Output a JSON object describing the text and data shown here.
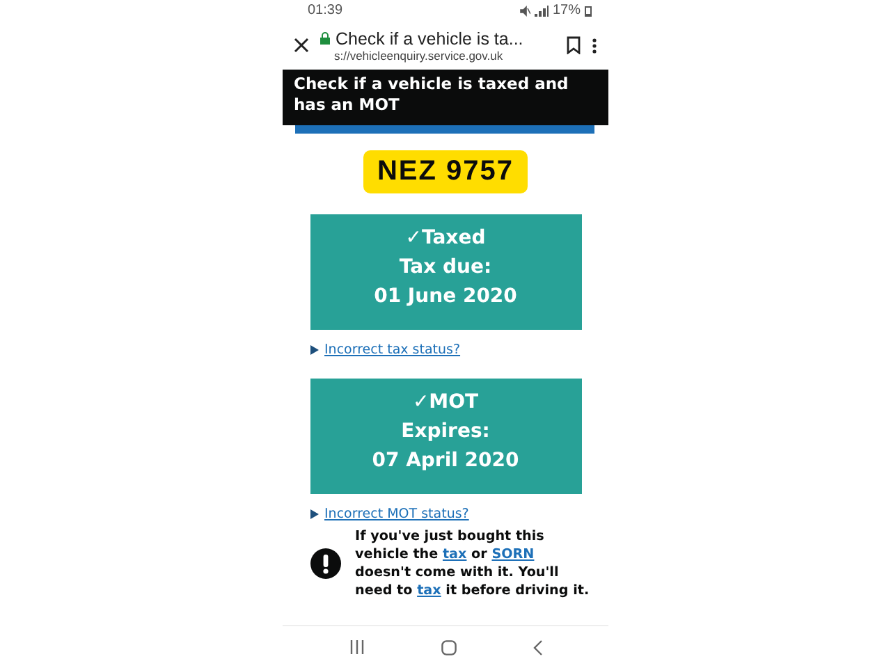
{
  "status_bar": {
    "time": "01:39",
    "battery": "17%"
  },
  "browser": {
    "title": "Check if a vehicle is ta...",
    "url": "s://vehicleenquiry.service.gov.uk"
  },
  "header": {
    "title": "Check if a vehicle is taxed and has an MOT"
  },
  "plate": "NEZ 9757",
  "statuses": [
    {
      "heading": "✓Taxed",
      "label": "Tax due:",
      "date": "01 June 2020",
      "link": "Incorrect tax status?"
    },
    {
      "heading": "✓MOT",
      "label": "Expires:",
      "date": "07 April 2020",
      "link": "Incorrect MOT status?"
    }
  ],
  "warning": {
    "parts": [
      {
        "kind": "text",
        "text": "If you've just bought this vehicle the "
      },
      {
        "kind": "link",
        "text": "tax"
      },
      {
        "kind": "text",
        "text": " or "
      },
      {
        "kind": "link",
        "text": "SORN"
      },
      {
        "kind": "text",
        "text": " doesn't come with it. You'll need to "
      },
      {
        "kind": "link",
        "text": "tax"
      },
      {
        "kind": "text",
        "text": " it before driving it."
      }
    ]
  }
}
